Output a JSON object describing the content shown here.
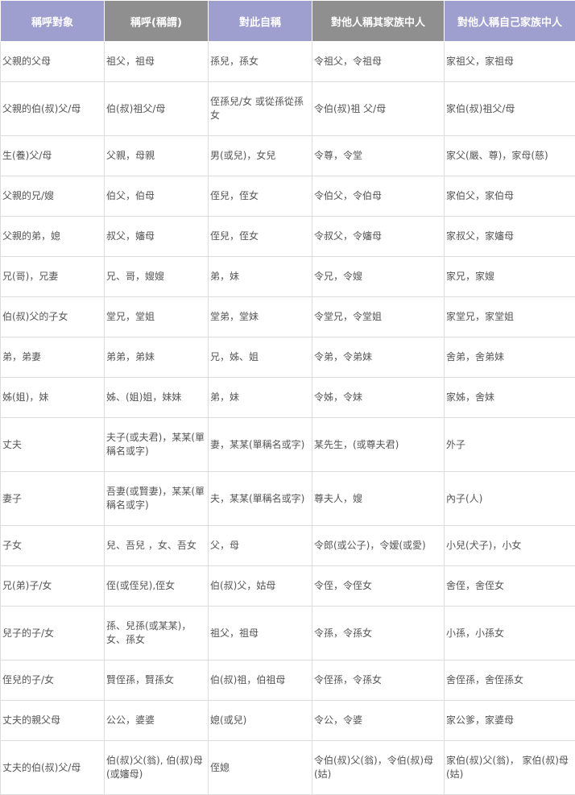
{
  "table": {
    "headers": [
      "稱呼對象",
      "稱呼(稱謂)",
      "對此自稱",
      "對他人稱其家族中人",
      "對他人稱自己家族中人"
    ],
    "rows": [
      [
        "父親的父母",
        "祖父，祖母",
        "孫兒，孫女",
        "令祖父，令祖母",
        "家祖父，家祖母"
      ],
      [
        "父親的伯(叔)父/母",
        "伯(叔)祖父/母",
        "侄孫兒/女 或從孫從孫女",
        "令伯(叔)祖 父/母",
        "家伯(叔)祖父/母"
      ],
      [
        "生(養)父/母",
        "父親，母親",
        "男(或兒)，女兒",
        "令尊，令堂",
        "家父(嚴、尊)，家母(慈)"
      ],
      [
        "父親的兄/嫂",
        "伯父，伯母",
        "侄兒，侄女",
        "令伯父，令伯母",
        "家伯父，家伯母"
      ],
      [
        "父親的弟，媳",
        "叔父，嬸母",
        "侄兒，侄女",
        "令叔父，令嬸母",
        "家叔父，家嬸母"
      ],
      [
        "兄(哥)，兄妻",
        "兄、哥，嫂嫂",
        "弟，妹",
        "令兄，令嫂",
        "家兄，家嫂"
      ],
      [
        "伯(叔)父的子女",
        "堂兄，堂姐",
        "堂弟，堂妹",
        "令堂兄，令堂姐",
        "家堂兄，家堂姐"
      ],
      [
        "弟，弟妻",
        "弟弟，弟妹",
        "兄，姊、姐",
        "令弟，令弟妹",
        "舍弟，舍弟妹"
      ],
      [
        "姊(姐)，妹",
        "姊、(姐)姐，妹妹",
        "弟，妹",
        "令姊，令妹",
        "家姊，舍妹"
      ],
      [
        "丈夫",
        "夫子(或夫君)，某某(單稱名或字)",
        "妻，某某(單稱名或字)",
        "某先生，(或尊夫君)",
        "外子"
      ],
      [
        "妻子",
        "吾妻(或賢妻)，某某(單稱名或字)",
        "夫，某某(單稱名或字)",
        "尊夫人，嫂",
        "內子(人)"
      ],
      [
        "子女",
        "兒、吾兒 ，女、吾女",
        "父，母",
        "令郎(或公子)，令嫒(或愛)",
        "小兒(犬子)，小女"
      ],
      [
        "兄(弟)子/女",
        "侄(或侄兒),侄女",
        "伯(叔)父，姑母",
        "令侄，令侄女",
        "舍侄，舍侄女"
      ],
      [
        "兒子的子/女",
        "孫、兒孫(或某某)，女、孫女",
        "祖父，祖母",
        "令孫，令孫女",
        "小孫，小孫女"
      ],
      [
        "侄兒的子/女",
        "賢侄孫，賢孫女",
        "伯(叔)祖，伯祖母",
        "令侄孫，令孫女",
        "舍侄孫，舍侄孫女"
      ],
      [
        "丈夫的親父母",
        "公公，婆婆",
        "媳(或兒)",
        "令公，令婆",
        "家公爹，家婆母"
      ],
      [
        "丈夫的伯(叔)父/母",
        "伯(叔)父(翁), 伯(叔)母(或嬸母)",
        "侄媳",
        "令伯(叔)父(翁)，令伯(叔)母(姑)",
        "家伯(叔)父(翁)， 家伯(叔)母(姑)"
      ]
    ]
  }
}
